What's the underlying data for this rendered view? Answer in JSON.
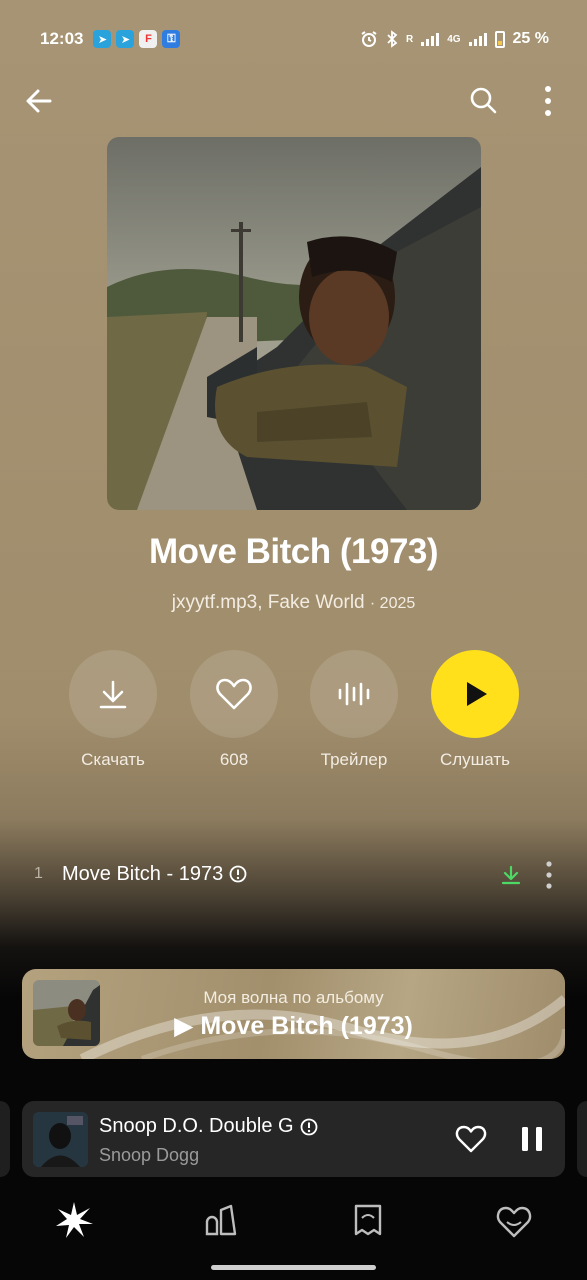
{
  "status": {
    "time": "12:03",
    "network": "4G",
    "roaming": "R",
    "battery": "25 %",
    "apps": [
      "telegram-icon",
      "telegram-icon",
      "figma-icon",
      "vpn-key-icon"
    ]
  },
  "album": {
    "title": "Move Bitch (1973)",
    "artists": "jxyytf.mp3, Fake World",
    "year": "2025"
  },
  "actions": {
    "download_label": "Скачать",
    "likes_count": "608",
    "trailer_label": "Трейлер",
    "listen_label": "Слушать"
  },
  "tracks": [
    {
      "number": "1",
      "title": "Move Bitch - 1973"
    }
  ],
  "wave": {
    "subtitle": "Моя волна по альбому",
    "title": "Move Bitch (1973)"
  },
  "now_playing": {
    "title": "Snoop D.O. Double G",
    "artist": "Snoop Dogg"
  },
  "colors": {
    "accent_yellow": "#ffe01a",
    "download_green": "#4cd964",
    "background": "#a69474"
  },
  "nav": [
    "wave-icon",
    "music-icon",
    "collection-icon",
    "favorites-icon"
  ]
}
